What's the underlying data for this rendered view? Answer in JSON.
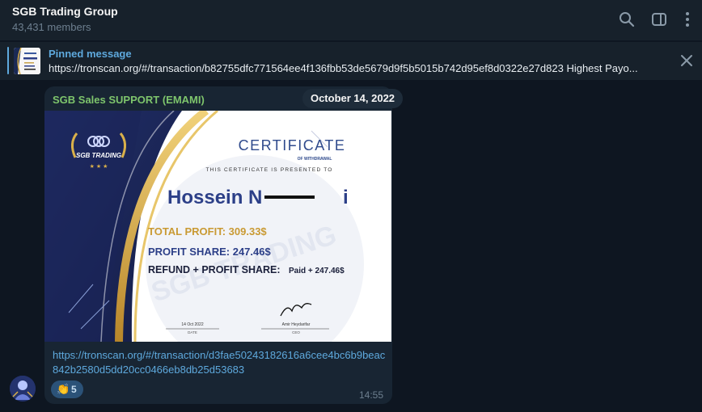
{
  "header": {
    "title": "SGB Trading Group",
    "members": "43,431 members"
  },
  "pinned": {
    "label": "Pinned message",
    "text": "https://tronscan.org/#/transaction/b82755dfc771564ee4f136fbb53de5679d9f5b5015b742d95ef8d0322e27d823  Highest Payo..."
  },
  "date": "October 14, 2022",
  "message": {
    "sender": "SGB Sales SUPPORT (EMAMI)",
    "link": "https://tronscan.org/#/transaction/d3fae50243182616a6cee4bc6b9beac842b2580d5dd20cc0466eb8db25d53683",
    "time": "14:55",
    "reaction": {
      "emoji": "👏",
      "count": "5"
    }
  },
  "certificate": {
    "title": "CERTIFICATE",
    "subtitle": "OF WITHDRAWAL",
    "presented": "THIS CERTIFICATE IS PRESENTED TO",
    "name": "Hossein N",
    "name_end": "i",
    "total_profit": "TOTAL PROFIT: 309.33$",
    "profit_share": "PROFIT SHARE: 247.46$",
    "refund_label": "REFUND + PROFIT SHARE:",
    "refund_value": "Paid + 247.46$",
    "date_value": "14 Oct 2022",
    "date_label": "DATE",
    "signer_name": "Amir Heydarifar",
    "signer_title": "CEO",
    "watermark": "SGB TRADING"
  },
  "icons": [
    "search-icon",
    "sidebar-toggle-icon",
    "more-icon",
    "close-icon",
    "sgb-logo"
  ],
  "colors": {
    "accent": "#5ea9dd",
    "sender": "#7ec56c",
    "bubble": "#182533",
    "background": "#0e1621"
  }
}
